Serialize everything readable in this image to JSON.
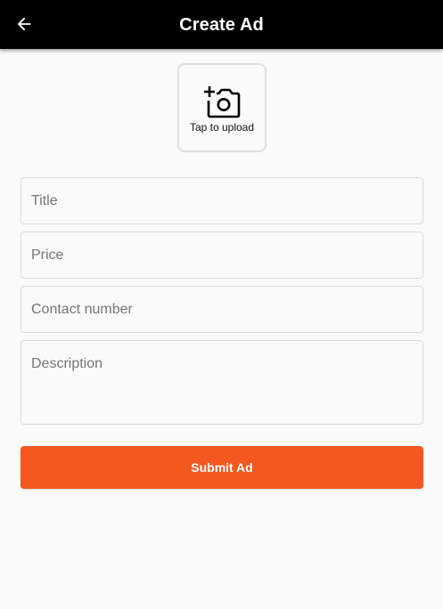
{
  "appbar": {
    "title": "Create Ad",
    "back_icon": "arrow-left-icon"
  },
  "upload": {
    "icon": "add-photo-camera-icon",
    "label": "Tap to upload"
  },
  "form": {
    "title_placeholder": "Title",
    "price_placeholder": "Price",
    "contact_placeholder": "Contact number",
    "description_placeholder": "Description",
    "submit_label": "Submit Ad"
  },
  "colors": {
    "appbar": "#000000",
    "background": "#fafafa",
    "accent": "#f4581f",
    "border": "#dcdcdc"
  }
}
